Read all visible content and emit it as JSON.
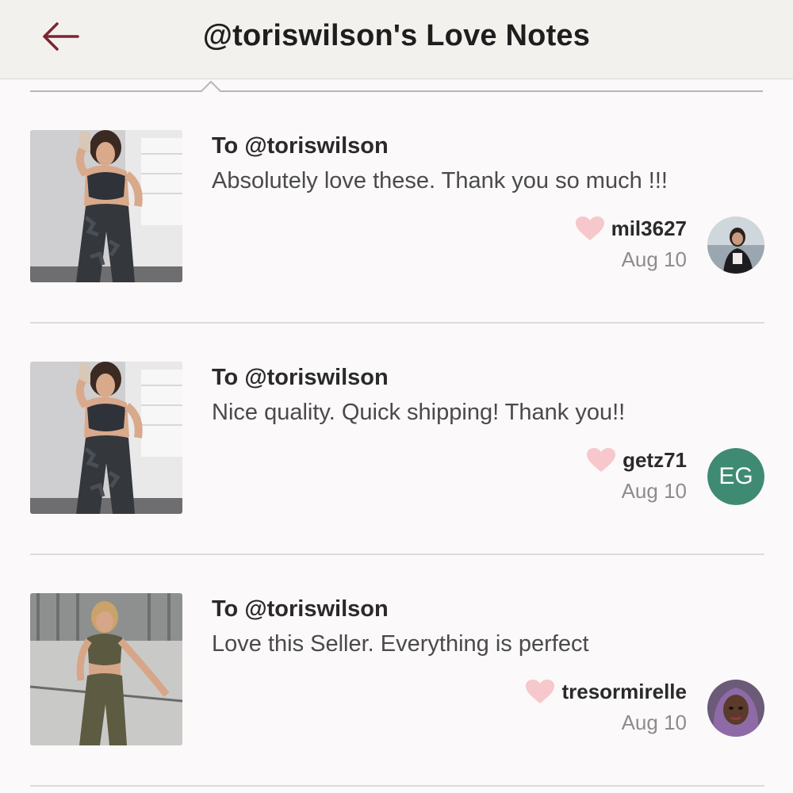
{
  "header": {
    "title": "@toriswilson's Love Notes",
    "back_icon": "arrow-left-icon",
    "back_color": "#7d2430"
  },
  "colors": {
    "heart": "#f6c7cb",
    "divider": "#dcdada",
    "initials_avatar": "#3f8a72"
  },
  "notes": [
    {
      "to": "To @toriswilson",
      "message": "Absolutely love these. Thank you so much !!!",
      "username": "mil3627",
      "date": "Aug 10",
      "avatar": {
        "type": "photo"
      },
      "product": "black-camo-set"
    },
    {
      "to": "To @toriswilson",
      "message": "Nice quality. Quick shipping! Thank you!!",
      "username": "getz71",
      "date": "Aug 10",
      "avatar": {
        "type": "initials",
        "initials": "EG"
      },
      "product": "black-camo-set"
    },
    {
      "to": "To @toriswilson",
      "message": "Love this Seller. Everything is perfect",
      "username": "tresormirelle",
      "date": "Aug 10",
      "avatar": {
        "type": "photo"
      },
      "product": "olive-set"
    }
  ]
}
